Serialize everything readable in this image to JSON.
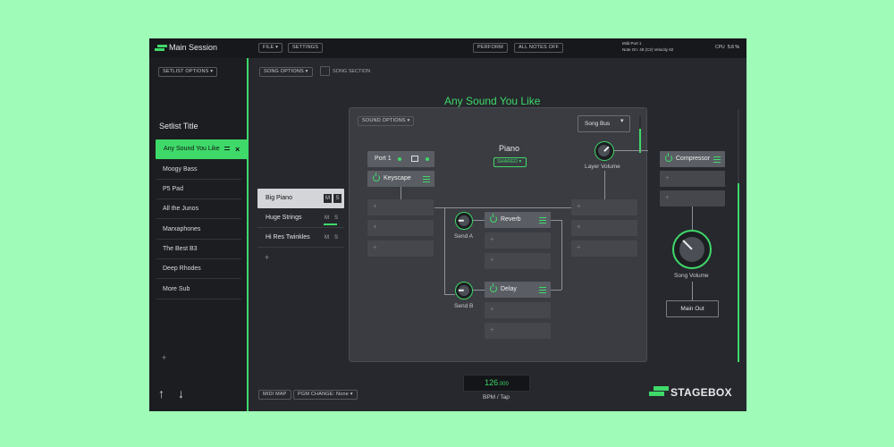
{
  "app": {
    "session_title": "Main Session",
    "menu": {
      "file": "FILE",
      "settings": "SETTINGS",
      "perform": "PERFORM",
      "all_notes_off": "ALL NOTES OFF"
    },
    "midi_status": {
      "line1": "Midi:Port 1",
      "line2": "Note On: 48 (C2) Velocity 82"
    },
    "cpu": {
      "label": "CPU",
      "value": "5.6 %"
    }
  },
  "sidebar": {
    "setlist_options": "SETLIST OPTIONS",
    "setlist_title": "Setlist Title",
    "active_song": "Any Sound You Like",
    "songs": [
      "Moogy Bass",
      "P5 Pad",
      "All the Junos",
      "Marxaphones",
      "The Best B3",
      "Deep Rhodes",
      "More Sub"
    ],
    "add": "+"
  },
  "main": {
    "song_options": "SONG OPTIONS",
    "song_section": "SONG SECTION",
    "song_title": "Any Sound You Like",
    "layers": [
      {
        "name": "Big Piano",
        "m": "M",
        "s": "S"
      },
      {
        "name": "Huge Strings",
        "m": "M",
        "s": "S"
      },
      {
        "name": "Hi Res Twinkles",
        "m": "M",
        "s": "S"
      }
    ],
    "add_layer": "+",
    "sound_options": "SOUND OPTIONS",
    "song_bus": "Song Bus",
    "sound_name": "Piano",
    "shared": "SHARED",
    "port": "Port 1",
    "instrument": "Keyscape",
    "reverb": "Reverb",
    "delay": "Delay",
    "send_a": "Send A",
    "send_b": "Send B",
    "layer_volume": "Layer Volume",
    "compressor": "Compressor",
    "song_volume": "Song Volume",
    "main_out": "Main Out",
    "plus": "+",
    "midi_map": "MIDI MAP",
    "pgm_change": "PGM CHANGE: None",
    "tempo_int": "126",
    "tempo_frac": ".000",
    "bpm_tap": "BPM / Tap",
    "brand": "STAGEBOX"
  },
  "colors": {
    "accent": "#3fd96a",
    "background": "#9ffcb8",
    "panel": "#26282d"
  }
}
